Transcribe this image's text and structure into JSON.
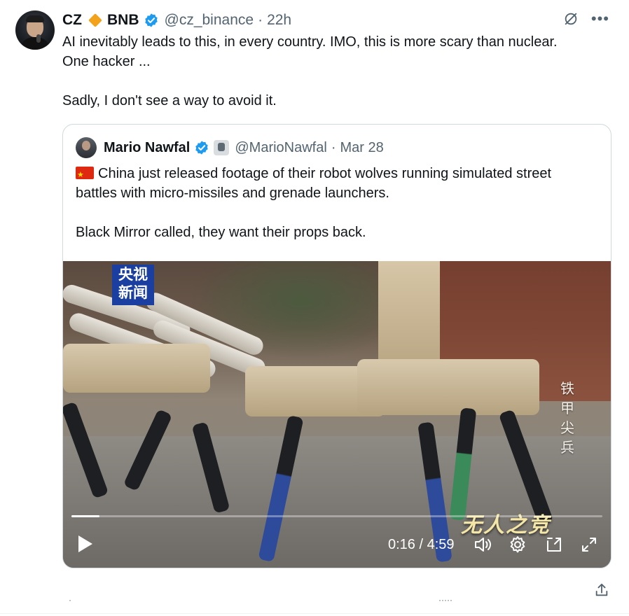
{
  "tweet": {
    "author_name": "CZ",
    "author_tag": "BNB",
    "handle": "@cz_binance",
    "separator": "·",
    "time": "22h",
    "text": "AI inevitably leads to this, in every country. IMO, this is more scary than nuclear.\nOne hacker ...\n\nSadly, I don't see a way to avoid it."
  },
  "quoted": {
    "author_name": "Mario Nawfal",
    "handle": "@MarioNawfal",
    "separator": "·",
    "date": "Mar 28",
    "text": "China just released footage of their robot wolves running simulated street\nbattles with micro-missiles and grenade launchers.\n\nBlack Mirror called, they want their props back.",
    "video": {
      "logo_line1": "央视",
      "logo_line2": "新闻",
      "vertical_caption": "铁甲尖兵",
      "brand_caption": "无人之竞",
      "current_time": "0:16",
      "time_separator": " / ",
      "duration": "4:59",
      "progress_fraction": 0.053
    }
  },
  "icons": [
    "grok-icon",
    "more-icon",
    "verified-icon",
    "play-icon",
    "volume-icon",
    "settings-icon",
    "pip-icon",
    "fullscreen-icon",
    "share-icon"
  ],
  "colors": {
    "verified": "#1d9bf0",
    "muted": "#536471",
    "bnb": "#f3a21b"
  }
}
